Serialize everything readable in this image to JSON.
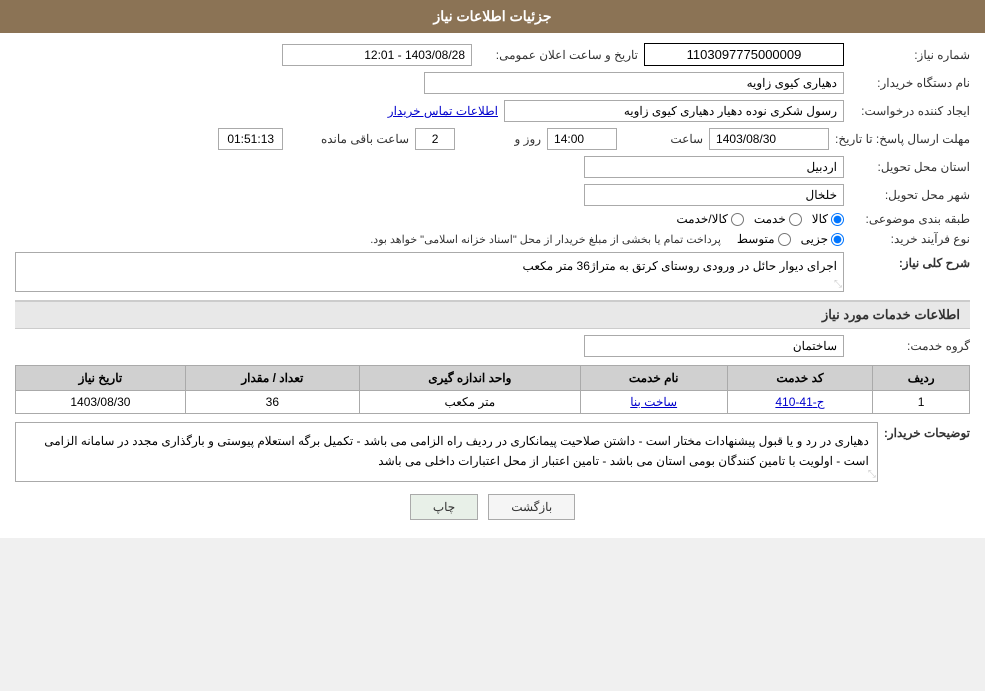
{
  "header": {
    "title": "جزئیات اطلاعات نیاز"
  },
  "fields": {
    "need_number_label": "شماره نیاز:",
    "need_number_value": "1103097775000009",
    "announce_date_label": "تاریخ و ساعت اعلان عمومی:",
    "announce_date_value": "1403/08/28 - 12:01",
    "buyer_station_label": "نام دستگاه خریدار:",
    "buyer_station_value": "دهیاری کیوی زاویه",
    "creator_label": "ایجاد کننده درخواست:",
    "creator_value": "رسول شکری نوده دهیار دهیاری کیوی زاویه",
    "contact_link": "اطلاعات تماس خریدار",
    "response_deadline_label": "مهلت ارسال پاسخ: تا تاریخ:",
    "date_value": "1403/08/30",
    "time_label": "ساعت",
    "time_value": "14:00",
    "days_label": "روز و",
    "days_value": "2",
    "remaining_label": "ساعت باقی مانده",
    "remaining_value": "01:51:13",
    "province_label": "استان محل تحویل:",
    "province_value": "اردبیل",
    "city_label": "شهر محل تحویل:",
    "city_value": "خلخال",
    "category_label": "طبقه بندی موضوعی:",
    "category_options": [
      "کالا",
      "خدمت",
      "کالا/خدمت"
    ],
    "category_selected": "کالا",
    "process_type_label": "نوع فرآیند خرید:",
    "process_options": [
      "جزیی",
      "متوسط"
    ],
    "process_note": "پرداخت تمام یا بخشی از مبلغ خریدار از محل \"اسناد خزانه اسلامی\" خواهد بود.",
    "description_label": "شرح کلی نیاز:",
    "description_value": "اجرای دیوار حائل در ورودی روستای کرتق به متراژ36 متر مکعب",
    "services_section_title": "اطلاعات خدمات مورد نیاز",
    "service_group_label": "گروه خدمت:",
    "service_group_value": "ساختمان",
    "table": {
      "headers": [
        "ردیف",
        "کد خدمت",
        "نام خدمت",
        "واحد اندازه گیری",
        "تعداد / مقدار",
        "تاریخ نیاز"
      ],
      "rows": [
        {
          "row": "1",
          "code": "ج-41-410",
          "name": "ساخت بنا",
          "unit": "متر مکعب",
          "quantity": "36",
          "date": "1403/08/30"
        }
      ]
    },
    "notes_label": "توضیحات خریدار:",
    "notes_value": "دهیاری در رد و یا قبول پیشنهادات مختار است - داشتن صلاحیت پیمانکاری در ردیف راه الزامی می باشد - تکمیل برگه استعلام پیوستی و بارگذاری مجدد در سامانه الزامی است - اولویت با تامین کنندگان بومی استان می باشد - تامین اعتبار از محل اعتبارات داخلی می باشد"
  },
  "buttons": {
    "back_label": "بازگشت",
    "print_label": "چاپ"
  }
}
